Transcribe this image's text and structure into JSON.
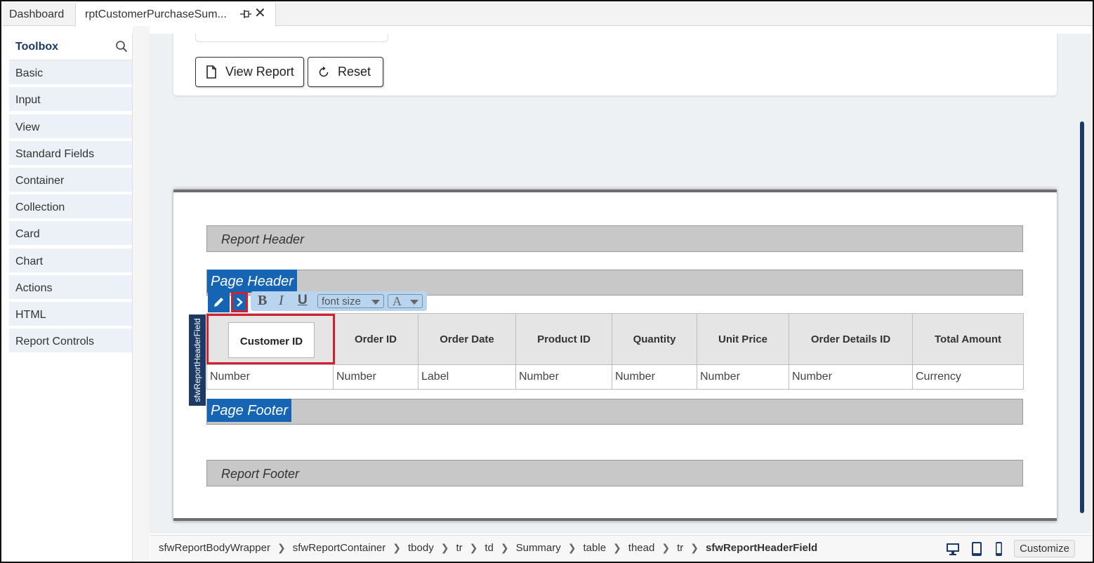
{
  "tabs": [
    {
      "label": "Dashboard"
    },
    {
      "label": "rptCustomerPurchaseSum..."
    }
  ],
  "toolbox": {
    "title": "Toolbox",
    "items": [
      "Basic",
      "Input",
      "View",
      "Standard Fields",
      "Container",
      "Collection",
      "Card",
      "Chart",
      "Actions",
      "HTML",
      "Report Controls"
    ]
  },
  "actions": {
    "view_report": "View Report",
    "reset": "Reset"
  },
  "report": {
    "report_header": "Report Header",
    "page_header": "Page Header",
    "page_footer": "Page Footer",
    "report_footer": "Report Footer",
    "selected_field_label": "sfwReportHeaderField",
    "toolbar": {
      "bold": "B",
      "italic": "I",
      "underline": "U",
      "font_size_placeholder": "font size",
      "font_color": "A"
    },
    "columns": [
      "Customer ID",
      "Order ID",
      "Order Date",
      "Product ID",
      "Quantity",
      "Unit Price",
      "Order Details ID",
      "Total Amount"
    ],
    "row_types": [
      "Number",
      "Number",
      "Label",
      "Number",
      "Number",
      "Number",
      "Number",
      "Currency"
    ]
  },
  "breadcrumb": [
    "sfwReportBodyWrapper",
    "sfwReportContainer",
    "tbody",
    "tr",
    "td",
    "Summary",
    "table",
    "thead",
    "tr",
    "sfwReportHeaderField"
  ],
  "bottom": {
    "customize": "Customize"
  },
  "colors": {
    "accent_blue": "#1565b4",
    "navy": "#1b3a66",
    "selection_red": "#d32030"
  }
}
